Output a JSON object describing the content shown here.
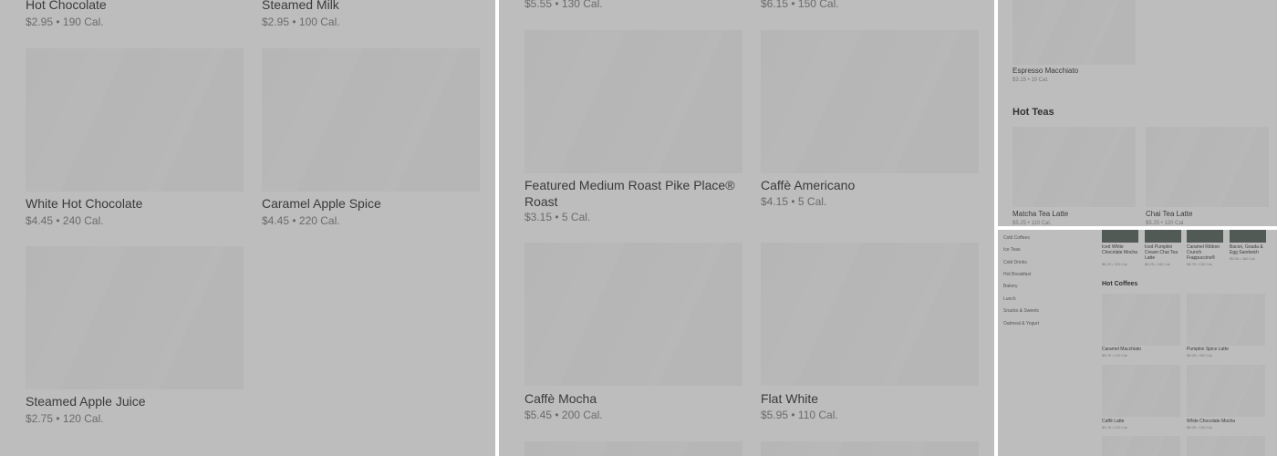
{
  "panel1": {
    "top_items": [
      {
        "name": "Hot Chocolate",
        "price": "$2.95",
        "calories": "190 Cal."
      },
      {
        "name": "Steamed Milk",
        "price": "$2.95",
        "calories": "100 Cal."
      }
    ],
    "items": [
      {
        "name": "White Hot Chocolate",
        "price": "$4.45",
        "calories": "240 Cal."
      },
      {
        "name": "Caramel Apple Spice",
        "price": "$4.45",
        "calories": "220 Cal."
      },
      {
        "name": "Steamed Apple Juice",
        "price": "$2.75",
        "calories": "120 Cal."
      }
    ]
  },
  "panel2": {
    "top_items": [
      {
        "price": "$5.55",
        "calories": "130 Cal."
      },
      {
        "price": "$6.15",
        "calories": "150 Cal."
      }
    ],
    "items": [
      {
        "name": "Featured Medium Roast Pike Place® Roast",
        "price": "$3.15",
        "calories": "5 Cal."
      },
      {
        "name": "Caffè Americano",
        "price": "$4.15",
        "calories": "5 Cal."
      },
      {
        "name": "Caffè Mocha",
        "price": "$5.45",
        "calories": "200 Cal."
      },
      {
        "name": "Flat White",
        "price": "$5.95",
        "calories": "110 Cal."
      }
    ]
  },
  "panel3": {
    "top_item": {
      "name": "Espresso Macchiato",
      "price": "$3.15",
      "calories": "10 Cal."
    },
    "section_title": "Hot Teas",
    "items": [
      {
        "name": "Matcha Tea Latte",
        "price": "$5.25",
        "calories": "110 Cal."
      },
      {
        "name": "Chai Tea Latte",
        "price": "$5.25",
        "calories": "120 Cal."
      }
    ]
  },
  "panel4": {
    "sidebar": [
      "Cold Coffees",
      "Ice Teas",
      "Cold Drinks",
      "Hot Breakfast",
      "Bakery",
      "Lunch",
      "Snacks & Sweets",
      "Oatmeal & Yogurt"
    ],
    "featured": [
      {
        "name": "Iced White Chocolate Mocha",
        "price": "$6.25",
        "calories": "320 Cal."
      },
      {
        "name": "Iced Pumpkin Cream Chai Tea Latte",
        "price": "$6.25",
        "calories": "240 Cal."
      },
      {
        "name": "Caramel Ribbon Crunch Frappuccino®",
        "price": "$6.75",
        "calories": "150 Cal."
      },
      {
        "name": "Bacon, Gouda & Egg Sandwich",
        "price": "$5.55",
        "calories": "360 Cal."
      }
    ],
    "section_title": "Hot Coffees",
    "items": [
      {
        "name": "Caramel Macchiato",
        "price": "$5.75",
        "calories": "120 Cal."
      },
      {
        "name": "Pumpkin Spice Latte",
        "price": "$6.25",
        "calories": "300 Cal."
      },
      {
        "name": "Caffè Latte",
        "price": "$4.75",
        "calories": "120 Cal."
      },
      {
        "name": "White Chocolate Mocha",
        "price": "$5.95",
        "calories": "190 Cal."
      }
    ]
  }
}
